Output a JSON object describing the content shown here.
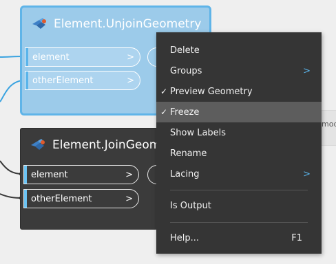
{
  "nodes": {
    "unjoin": {
      "title": "Element.UnjoinGeometry",
      "inputs": [
        "element",
        "otherElement"
      ],
      "chevron": ">",
      "footer": "⋮"
    },
    "join": {
      "title": "Element.JoinGeometry",
      "title_visible": "Element.JoinGeome",
      "inputs": [
        "element",
        "otherElement"
      ],
      "chevron": ">"
    },
    "side_node_text": "mode"
  },
  "context_menu": {
    "items": [
      {
        "label": "Delete",
        "checked": false,
        "submenu": false
      },
      {
        "label": "Groups",
        "checked": false,
        "submenu": true
      },
      {
        "label": "Preview Geometry",
        "checked": true,
        "submenu": false
      },
      {
        "label": "Freeze",
        "checked": true,
        "submenu": false,
        "highlighted": true
      },
      {
        "label": "Show Labels",
        "checked": false,
        "submenu": false
      },
      {
        "label": "Rename",
        "checked": false,
        "submenu": false
      },
      {
        "label": "Lacing",
        "checked": false,
        "submenu": true
      },
      {
        "label": "Is Output",
        "checked": false,
        "submenu": false
      },
      {
        "label": "Help...",
        "checked": false,
        "submenu": false,
        "shortcut": "F1"
      }
    ],
    "check_glyph": "✓",
    "submenu_glyph": ">"
  },
  "colors": {
    "canvas": "#efefef",
    "selected_node": "#9ccbea",
    "selected_border": "#5fb4e8",
    "node_dark": "#3b3b3b",
    "menu_bg": "#353535",
    "menu_hover": "#5d5d5d",
    "accent": "#5ab4ea",
    "wire": "#3a3a3a"
  },
  "icons": [
    "node-geometry-icon",
    "submenu-arrow-icon",
    "checkmark-icon",
    "port-chevron-icon"
  ]
}
